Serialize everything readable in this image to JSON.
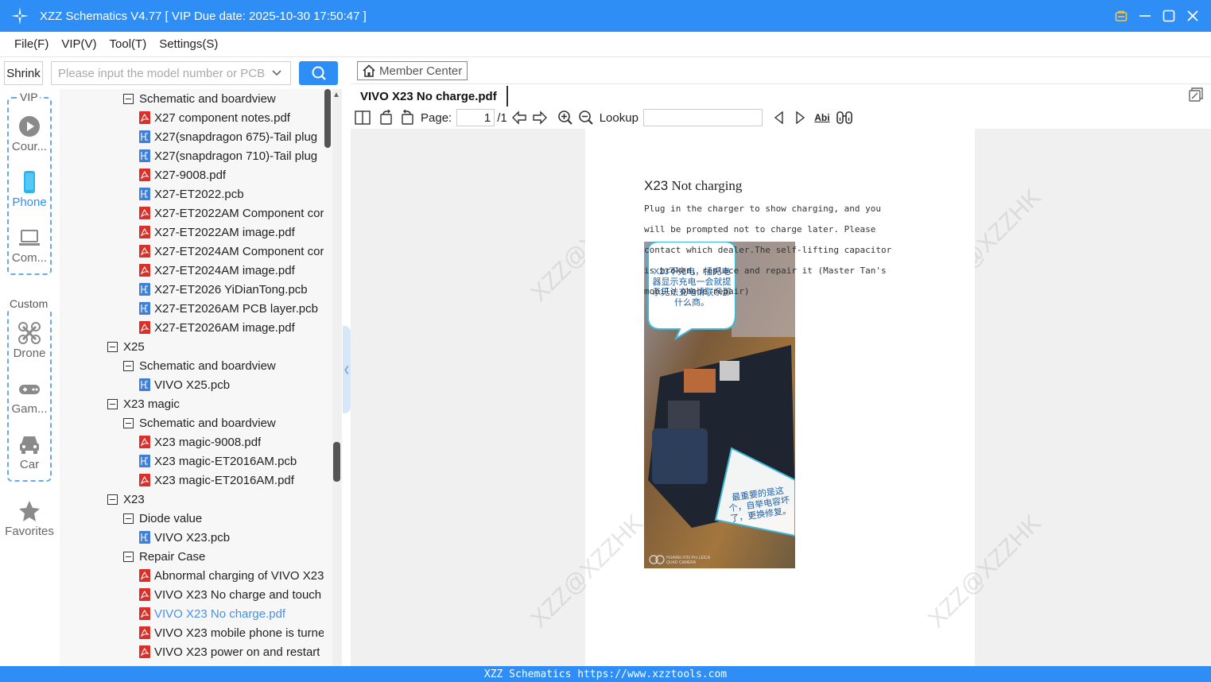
{
  "titlebar": {
    "title": "XZZ Schematics V4.77 [ VIP Due date: 2025-10-30 17:50:47 ]"
  },
  "menu": [
    "File(F)",
    "VIP(V)",
    "Tool(T)",
    "Settings(S)"
  ],
  "left_toolbar": {
    "shrink_label": "Shrink",
    "search_placeholder": "Please input the model number or PCB"
  },
  "categories": {
    "vip_label": "VIP",
    "custom_label": "Custom",
    "items": [
      {
        "label": "Cour...",
        "icon": "play-icon"
      },
      {
        "label": "Phone",
        "icon": "phone-icon",
        "active": true
      },
      {
        "label": "Com...",
        "icon": "laptop-icon"
      },
      {
        "label": "Drone",
        "icon": "drone-icon"
      },
      {
        "label": "Gam...",
        "icon": "gamepad-icon"
      },
      {
        "label": "Car",
        "icon": "car-icon"
      },
      {
        "label": "Favorites",
        "icon": "star-icon"
      }
    ]
  },
  "tree": [
    {
      "level": 1,
      "kind": "folder",
      "text": "Schematic and boardview"
    },
    {
      "level": 2,
      "kind": "pdf",
      "text": "X27 component notes.pdf"
    },
    {
      "level": 2,
      "kind": "pcb",
      "text": "X27(snapdragon 675)-Tail plug"
    },
    {
      "level": 2,
      "kind": "pcb",
      "text": "X27(snapdragon 710)-Tail plug"
    },
    {
      "level": 2,
      "kind": "pdf",
      "text": "X27-9008.pdf"
    },
    {
      "level": 2,
      "kind": "pcb",
      "text": "X27-ET2022.pcb"
    },
    {
      "level": 2,
      "kind": "pdf",
      "text": "X27-ET2022AM Component cor"
    },
    {
      "level": 2,
      "kind": "pdf",
      "text": "X27-ET2022AM image.pdf"
    },
    {
      "level": 2,
      "kind": "pdf",
      "text": "X27-ET2024AM Component cor"
    },
    {
      "level": 2,
      "kind": "pdf",
      "text": "X27-ET2024AM image.pdf"
    },
    {
      "level": 2,
      "kind": "pcb",
      "text": "X27-ET2026 YiDianTong.pcb"
    },
    {
      "level": 2,
      "kind": "pcb",
      "text": "X27-ET2026AM PCB layer.pcb"
    },
    {
      "level": 2,
      "kind": "pdf",
      "text": "X27-ET2026AM image.pdf"
    },
    {
      "level": 0,
      "kind": "folder",
      "text": "X25"
    },
    {
      "level": 1,
      "kind": "folder",
      "text": "Schematic and boardview"
    },
    {
      "level": 2,
      "kind": "pcb",
      "text": "VIVO X25.pcb"
    },
    {
      "level": 0,
      "kind": "folder",
      "text": "X23 magic"
    },
    {
      "level": 1,
      "kind": "folder",
      "text": "Schematic and boardview"
    },
    {
      "level": 2,
      "kind": "pdf",
      "text": "X23 magic-9008.pdf"
    },
    {
      "level": 2,
      "kind": "pcb",
      "text": "X23 magic-ET2016AM.pcb"
    },
    {
      "level": 2,
      "kind": "pdf",
      "text": "X23 magic-ET2016AM.pdf"
    },
    {
      "level": 0,
      "kind": "folder",
      "text": "X23"
    },
    {
      "level": 1,
      "kind": "folder",
      "text": "Diode value"
    },
    {
      "level": 2,
      "kind": "pcb",
      "text": "VIVO X23.pcb"
    },
    {
      "level": 1,
      "kind": "folder",
      "text": "Repair Case"
    },
    {
      "level": 2,
      "kind": "pdf",
      "text": "Abnormal charging of VIVO X23"
    },
    {
      "level": 2,
      "kind": "pdf",
      "text": "VIVO X23 No charge and touch"
    },
    {
      "level": 2,
      "kind": "pdf",
      "text": "VIVO X23 No charge.pdf",
      "selected": true
    },
    {
      "level": 2,
      "kind": "pdf",
      "text": "VIVO X23 mobile phone is turne"
    },
    {
      "level": 2,
      "kind": "pdf",
      "text": "VIVO X23 power on and restart"
    }
  ],
  "viewer": {
    "member_center": "Member Center",
    "doc_tab": "VIVO X23 No charge.pdf",
    "page_label": "Page:",
    "page_value": "1",
    "page_total": "/1",
    "lookup_label": "Lookup",
    "abi_label": "Abi"
  },
  "document": {
    "title_model": "X23",
    "title_rest": "Not charging",
    "paragraph": "Plug in the charger to show charging, and you will be prompted not to charge later. Please contact which dealer.The self-lifting capacitor is broken, replace and repair it (Master Tan's mobile phone repair)",
    "bubble_top": "X23不充电，插充电器显示充电一会就提示无法充电请联系那什么商。",
    "bubble_bottom": "最重要的是这个，自举电容坏了，更换修复。",
    "camera_mark": "HUAWEI P30 Pro LEICA QUAD CAMERA",
    "watermark": "XZZ@XZZHK"
  },
  "statusbar": "XZZ Schematics https://www.xzztools.com",
  "colors": {
    "accent": "#2f8ef5",
    "pdf": "#d9302c",
    "pcb": "#3f7fd6",
    "selected": "#4a90e2"
  }
}
